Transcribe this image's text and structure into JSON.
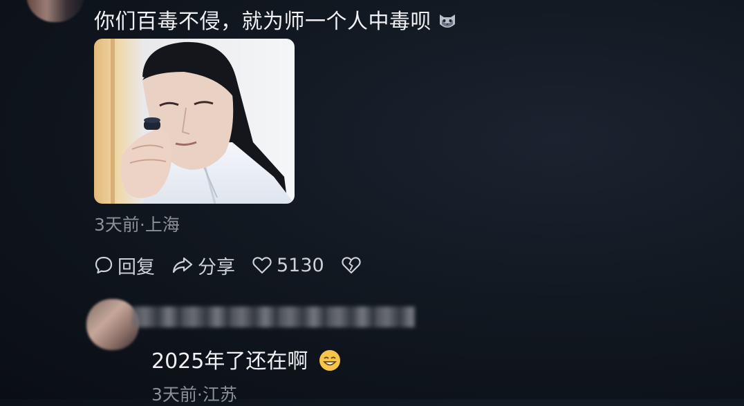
{
  "comment": {
    "text": "你们百毒不侵，就为师一个人中毒呗",
    "emoji_icon": "cat-emoji-icon",
    "meta": "3天前·上海"
  },
  "actions": {
    "reply_label": "回复",
    "share_label": "分享",
    "like_count": "5130"
  },
  "reply": {
    "text": "2025年了还在啊",
    "emoji_icon": "grinning-face-emoji",
    "meta": "3天前·江苏"
  }
}
